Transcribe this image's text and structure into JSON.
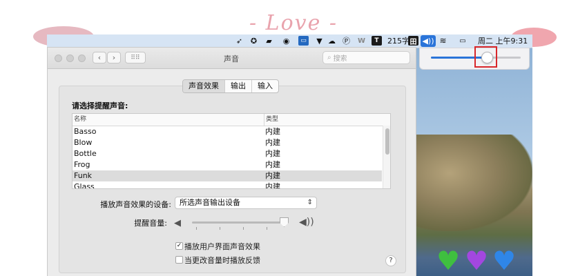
{
  "decor": {
    "love_text": "- Love -"
  },
  "menubar": {
    "icons": [
      "send-icon",
      "accessibility-icon",
      "chat-icon",
      "monitor-icon",
      "screen-icon",
      "vpn-icon",
      "cloud-icon",
      "paypal-icon",
      "w-icon",
      "t-icon"
    ],
    "word_count": "215字",
    "input_method": "田",
    "volume_icon": "◀))",
    "wifi_icon": "wifi-icon",
    "battery_icon": "battery-icon",
    "datetime": "周二 上午9:31",
    "t_label": "T",
    "w_label": "W"
  },
  "volume_popover": {
    "level": 0.62
  },
  "window": {
    "title": "声音",
    "search_placeholder": "搜索",
    "tabs": [
      {
        "label": "声音效果",
        "active": true
      },
      {
        "label": "输出",
        "active": false
      },
      {
        "label": "输入",
        "active": false
      }
    ],
    "alert_label": "请选择提醒声音:",
    "table": {
      "columns": {
        "name": "名称",
        "type": "类型"
      },
      "rows": [
        {
          "name": "Basso",
          "type": "内建",
          "selected": false
        },
        {
          "name": "Blow",
          "type": "内建",
          "selected": false
        },
        {
          "name": "Bottle",
          "type": "内建",
          "selected": false
        },
        {
          "name": "Frog",
          "type": "内建",
          "selected": false
        },
        {
          "name": "Funk",
          "type": "内建",
          "selected": true
        },
        {
          "name": "Glass",
          "type": "内建",
          "selected": false
        }
      ]
    },
    "device_label": "播放声音效果的设备:",
    "device_value": "所选声音输出设备",
    "alert_volume_label": "提醒音量:",
    "alert_volume_level": 0.95,
    "checkbox_ui_sounds": {
      "label": "播放用户界面声音效果",
      "checked": true
    },
    "checkbox_feedback": {
      "label": "当更改音量时播放反馈",
      "checked": false
    },
    "help_label": "?"
  },
  "hearts": [
    "#3fbf3f",
    "#a347e0",
    "#2f86e8"
  ]
}
